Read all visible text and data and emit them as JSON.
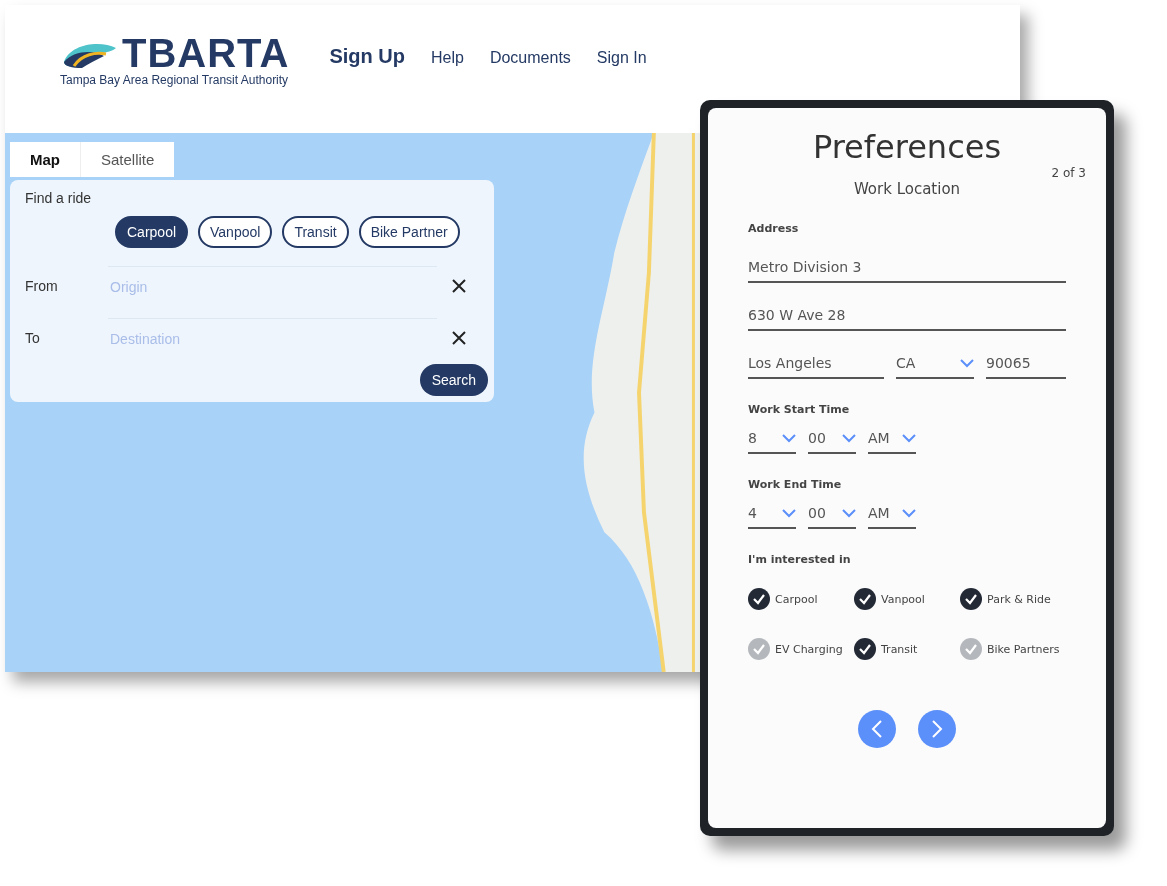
{
  "header": {
    "logo_word": "TBARTA",
    "logo_subtitle": "Tampa Bay Area Regional Transit Authority",
    "nav": [
      {
        "label": "Sign Up",
        "selected": true
      },
      {
        "label": "Help",
        "selected": false
      },
      {
        "label": "Documents",
        "selected": false
      },
      {
        "label": "Sign In",
        "selected": false
      }
    ]
  },
  "map_tabs": [
    {
      "label": "Map",
      "selected": true
    },
    {
      "label": "Satellite",
      "selected": false
    }
  ],
  "find_ride": {
    "title": "Find a ride",
    "modes": [
      {
        "label": "Carpool",
        "selected": true
      },
      {
        "label": "Vanpool",
        "selected": false
      },
      {
        "label": "Transit",
        "selected": false
      },
      {
        "label": "Bike Partner",
        "selected": false
      }
    ],
    "fields": [
      {
        "label": "From",
        "placeholder": "Origin"
      },
      {
        "label": "To",
        "placeholder": "Destination"
      }
    ],
    "search_button": "Search"
  },
  "preferences": {
    "title": "Preferences",
    "step": "2 of 3",
    "section": "Work Location",
    "address_label": "Address",
    "address_lines": [
      "Metro Division 3",
      "630 W Ave 28"
    ],
    "city": "Los Angeles",
    "state": "CA",
    "zip": "90065",
    "start_label": "Work Start Time",
    "start": {
      "hour": "8",
      "minute": "00",
      "period": "AM"
    },
    "end_label": "Work End Time",
    "end": {
      "hour": "4",
      "minute": "00",
      "period": "AM"
    },
    "interests_label": "I'm interested in",
    "interests": [
      {
        "label": "Carpool",
        "checked": true
      },
      {
        "label": "Vanpool",
        "checked": true
      },
      {
        "label": "Park & Ride",
        "checked": true
      },
      {
        "label": "EV Charging",
        "checked": false
      },
      {
        "label": "Transit",
        "checked": true
      },
      {
        "label": "Bike Partners",
        "checked": false
      }
    ]
  }
}
